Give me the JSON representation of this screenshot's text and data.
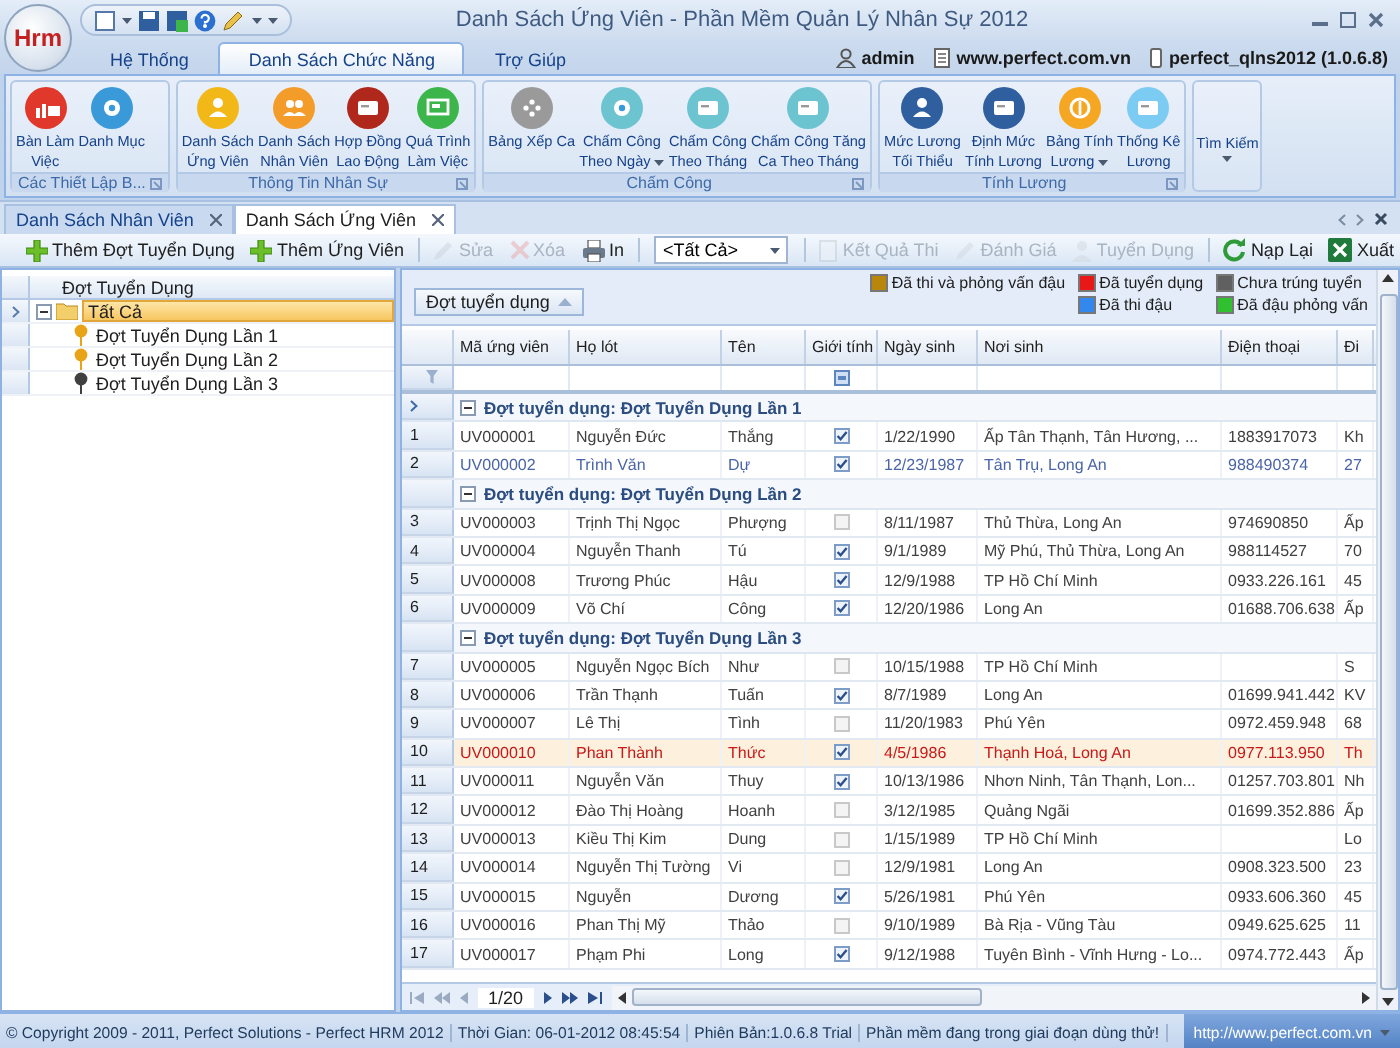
{
  "window": {
    "logo": "Hrm",
    "title": "Danh Sách Ứng Viên - Phần Mềm Quản Lý Nhân Sự 2012"
  },
  "ribbon": {
    "tabs": [
      {
        "label": "Hệ Thống",
        "selected": false
      },
      {
        "label": "Danh Sách Chức Năng",
        "selected": true
      },
      {
        "label": "Trợ Giúp",
        "selected": false
      }
    ],
    "user_info": [
      "admin",
      "www.perfect.com.vn",
      "perfect_qlns2012 (1.0.6.8)"
    ],
    "groups": [
      {
        "label": "Các Thiết Lập B...",
        "buttons": [
          {
            "lines": [
              "Bàn Làm",
              "Việc"
            ],
            "color": "#e0392b",
            "dropdown": false
          },
          {
            "lines": [
              "Danh Mục"
            ],
            "color": "#3a9ad9",
            "dropdown": false
          }
        ]
      },
      {
        "label": "Thông Tin Nhân Sự",
        "buttons": [
          {
            "lines": [
              "Danh Sách",
              "Ứng Viên"
            ],
            "color": "#f2b818",
            "dropdown": false
          },
          {
            "lines": [
              "Danh Sách",
              "Nhân Viên"
            ],
            "color": "#f39c2a",
            "dropdown": false
          },
          {
            "lines": [
              "Hợp Đồng",
              "Lao Động"
            ],
            "color": "#b0281c",
            "dropdown": false
          },
          {
            "lines": [
              "Quá Trình",
              "Làm Việc"
            ],
            "color": "#3cb64a",
            "dropdown": false
          }
        ]
      },
      {
        "label": "Chấm Công",
        "buttons": [
          {
            "lines": [
              "Bảng Xếp Ca"
            ],
            "color": "#9a9a9a",
            "dropdown": false
          },
          {
            "lines": [
              "Chấm Công",
              "Theo Ngày"
            ],
            "color": "#6cc4d0",
            "dropdown": true
          },
          {
            "lines": [
              "Chấm Công",
              "Theo Tháng"
            ],
            "color": "#6cc4d0",
            "dropdown": false
          },
          {
            "lines": [
              "Chấm Công Tăng",
              "Ca Theo Tháng"
            ],
            "color": "#6cc4d0",
            "dropdown": false
          }
        ]
      },
      {
        "label": "Tính Lương",
        "buttons": [
          {
            "lines": [
              "Mức Lương",
              "Tối Thiểu"
            ],
            "color": "#2f5f9e",
            "dropdown": false
          },
          {
            "lines": [
              "Định Mức",
              "Tính Lương"
            ],
            "color": "#2f5f9e",
            "dropdown": false
          },
          {
            "lines": [
              "Bảng Tính",
              "Lương"
            ],
            "color": "#f5a623",
            "dropdown": true
          },
          {
            "lines": [
              "Thống Kê",
              "Lương"
            ],
            "color": "#7ccbf2",
            "dropdown": false
          }
        ]
      }
    ],
    "search_button": {
      "lines": [
        "Tìm Kiếm"
      ],
      "dropdown": true
    }
  },
  "doc_tabs": [
    {
      "label": "Danh Sách Nhân Viên",
      "selected": false
    },
    {
      "label": "Danh Sách Ứng Viên",
      "selected": true
    }
  ],
  "toolbar": [
    {
      "kind": "add",
      "label": "Thêm Đợt Tuyển Dụng",
      "disabled": false
    },
    {
      "kind": "add",
      "label": "Thêm Ứng Viên",
      "disabled": false
    },
    {
      "kind": "edit",
      "label": "Sửa",
      "disabled": true
    },
    {
      "kind": "delete",
      "label": "Xóa",
      "disabled": true
    },
    {
      "kind": "print",
      "label": "In",
      "disabled": false
    },
    {
      "kind": "combo",
      "label": "<Tất Cả>"
    },
    {
      "kind": "result",
      "label": "Kết Quả Thi",
      "disabled": true
    },
    {
      "kind": "review",
      "label": "Đánh Giá",
      "disabled": true
    },
    {
      "kind": "hire",
      "label": "Tuyển Dụng",
      "disabled": true
    },
    {
      "kind": "reload",
      "label": "Nạp Lại",
      "disabled": false
    },
    {
      "kind": "export",
      "label": "Xuất",
      "disabled": false
    }
  ],
  "tree": {
    "header": "Đợt Tuyển Dụng",
    "items": [
      {
        "label": "Tất Cả",
        "selected": true,
        "expanded": true,
        "children": [
          {
            "label": "Đợt Tuyển Dụng Lần 1",
            "selected": false,
            "color": "#e8a317"
          },
          {
            "label": "Đợt Tuyển Dụng Lần 2",
            "selected": false,
            "color": "#e8a317"
          },
          {
            "label": "Đợt Tuyển Dụng Lần 3",
            "selected": false,
            "color": "#404040"
          }
        ]
      }
    ]
  },
  "grid": {
    "group_by": "Đợt tuyển dụng",
    "legend": [
      {
        "label": "Đã thi và phỏng vấn đậu",
        "color": "#b8860b"
      },
      {
        "label": "Đã tuyển dụng",
        "color": "#e81818"
      },
      {
        "label": "Chưa trúng tuyển",
        "color": "#606060"
      },
      {
        "label": "Đã thi đậu",
        "color": "#3388ee"
      },
      {
        "label": "Đã đậu phỏng vấn",
        "color": "#30c030"
      }
    ],
    "columns": [
      "Mã ứng viên",
      "Họ lót",
      "Tên",
      "Giới tính",
      "Ngày sinh",
      "Nơi sinh",
      "Điện thoại",
      "Đi"
    ],
    "groups": [
      {
        "label": "Đợt tuyển dụng: Đợt Tuyển Dụng Lần 1",
        "expanded": true,
        "current": true,
        "rows": [
          {
            "no": "1",
            "cells": [
              "UV000001",
              "Nguyễn Đức",
              "Thắng",
              "1/22/1990",
              "Ấp Tân Thạnh, Tân Hương, ...",
              "1883917073",
              "Kh"
            ],
            "checked": true,
            "color": "#404040",
            "selected": false
          },
          {
            "no": "2",
            "cells": [
              "UV000002",
              "Trình Văn",
              "Dự",
              "12/23/1987",
              "Tân Trụ, Long An",
              "988490374",
              "27"
            ],
            "checked": true,
            "color": "#4a64a8",
            "selected": false
          }
        ]
      },
      {
        "label": "Đợt tuyển dụng: Đợt Tuyển Dụng Lần 2",
        "expanded": true,
        "current": false,
        "rows": [
          {
            "no": "3",
            "cells": [
              "UV000003",
              "Trịnh Thị Ngọc",
              "Phượng",
              "8/11/1987",
              "Thủ Thừa, Long An",
              "974690850",
              "Ấp"
            ],
            "checked": false,
            "color": "#404040",
            "selected": false
          },
          {
            "no": "4",
            "cells": [
              "UV000004",
              "Nguyễn Thanh",
              "Tú",
              "9/1/1989",
              "Mỹ Phú, Thủ Thừa, Long An",
              "988114527",
              "70"
            ],
            "checked": true,
            "color": "#404040",
            "selected": false
          },
          {
            "no": "5",
            "cells": [
              "UV000008",
              "Trương Phúc",
              "Hậu",
              "12/9/1988",
              "TP Hồ Chí Minh",
              "0933.226.161",
              "45"
            ],
            "checked": true,
            "color": "#404040",
            "selected": false
          },
          {
            "no": "6",
            "cells": [
              "UV000009",
              "Võ Chí",
              "Công",
              "12/20/1986",
              "Long An",
              "01688.706.638",
              "Ấp"
            ],
            "checked": true,
            "color": "#404040",
            "selected": false
          }
        ]
      },
      {
        "label": "Đợt tuyển dụng: Đợt Tuyển Dụng Lần 3",
        "expanded": true,
        "current": false,
        "rows": [
          {
            "no": "7",
            "cells": [
              "UV000005",
              "Nguyễn Ngọc Bích",
              "Như",
              "10/15/1988",
              "TP Hồ Chí Minh",
              null,
              "S"
            ],
            "checked": false,
            "color": "#404040",
            "selected": false
          },
          {
            "no": "8",
            "cells": [
              "UV000006",
              "Trần Thạnh",
              "Tuấn",
              "8/7/1989",
              "Long An",
              "01699.941.442",
              "KV"
            ],
            "checked": true,
            "color": "#404040",
            "selected": false
          },
          {
            "no": "9",
            "cells": [
              "UV000007",
              "Lê Thị",
              "Tình",
              "11/20/1983",
              "Phú Yên",
              "0972.459.948",
              "68"
            ],
            "checked": false,
            "color": "#404040",
            "selected": false
          },
          {
            "no": "10",
            "cells": [
              "UV000010",
              "Phan Thành",
              "Thức",
              "4/5/1986",
              "Thạnh Hoá, Long An",
              "0977.113.950",
              "Th"
            ],
            "checked": true,
            "color": "#c81818",
            "selected": true
          },
          {
            "no": "11",
            "cells": [
              "UV000011",
              "Nguyễn Văn",
              "Thuy",
              "10/13/1986",
              "Nhơn Ninh, Tân Thạnh, Lon...",
              "01257.703.801",
              "Nh"
            ],
            "checked": true,
            "color": "#404040",
            "selected": false
          },
          {
            "no": "12",
            "cells": [
              "UV000012",
              "Đào Thị Hoàng",
              "Hoanh",
              "3/12/1985",
              "Quảng Ngãi",
              "01699.352.886",
              "Ấp"
            ],
            "checked": false,
            "color": "#404040",
            "selected": false
          },
          {
            "no": "13",
            "cells": [
              "UV000013",
              "Kiều Thị Kim",
              "Dung",
              "1/15/1989",
              "TP Hồ Chí Minh",
              null,
              "Lo"
            ],
            "checked": false,
            "color": "#404040",
            "selected": false
          },
          {
            "no": "14",
            "cells": [
              "UV000014",
              "Nguyễn Thị Tường",
              "Vi",
              "12/9/1981",
              "Long An",
              "0908.323.500",
              "23"
            ],
            "checked": false,
            "color": "#404040",
            "selected": false
          },
          {
            "no": "15",
            "cells": [
              "UV000015",
              "Nguyễn",
              "Dương",
              "5/26/1981",
              "Phú Yên",
              "0933.606.360",
              "45"
            ],
            "checked": true,
            "color": "#404040",
            "selected": false
          },
          {
            "no": "16",
            "cells": [
              "UV000016",
              "Phan Thị Mỹ",
              "Thảo",
              "9/10/1989",
              "Bà Rịa - Vũng Tàu",
              "0949.625.625",
              "11"
            ],
            "checked": false,
            "color": "#404040",
            "selected": false
          },
          {
            "no": "17",
            "cells": [
              "UV000017",
              "Phạm Phi",
              "Long",
              "9/12/1988",
              "Tuyên Bình - Vĩnh Hưng - Lo...",
              "0974.772.443",
              "Ấp"
            ],
            "checked": true,
            "color": "#404040",
            "selected": false
          }
        ]
      }
    ],
    "pager": "1/20"
  },
  "status_bar": {
    "segments": [
      "© Copyright 2009 - 2011, Perfect Solutions - Perfect HRM 2012",
      "Thời Gian: 06-01-2012 08:45:54",
      "Phiên Bản:1.0.6.8 Trial",
      "Phần mềm đang trong giai đoạn dùng thử!"
    ],
    "link": "http://www.perfect.com.vn"
  }
}
